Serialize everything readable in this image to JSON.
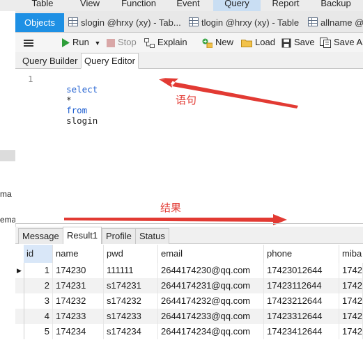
{
  "menu": [
    "Table",
    "View",
    "Function",
    "Event",
    "Query",
    "Report",
    "Backup"
  ],
  "menu_active": "Query",
  "left_tree": [
    "ma",
    "ema"
  ],
  "tabs": [
    {
      "label": "Objects",
      "active": true,
      "icon": ""
    },
    {
      "label": "slogin @hrxy (xy) - Tab...",
      "active": false,
      "icon": "table-icon"
    },
    {
      "label": "tlogin @hrxy (xy) - Table",
      "active": false,
      "icon": "table-icon"
    },
    {
      "label": "allname @",
      "active": false,
      "icon": "table-icon"
    }
  ],
  "toolbar": {
    "run": "Run",
    "stop": "Stop",
    "explain": "Explain",
    "new": "New",
    "load": "Load",
    "save": "Save",
    "save_as": "Save As"
  },
  "subtabs": [
    "Query Builder",
    "Query Editor"
  ],
  "editor": {
    "line_number": "1",
    "kw_select": "select",
    "star": "*",
    "kw_from": "from",
    "table": "slogin"
  },
  "annotations": {
    "statement": "语句",
    "result": "结果",
    "color": "#e23a33"
  },
  "result_tabs": [
    "Message",
    "Result1",
    "Profile",
    "Status"
  ],
  "grid": {
    "columns": [
      "id",
      "name",
      "pwd",
      "email",
      "phone",
      "miba"
    ],
    "rows": [
      [
        "1",
        "174230",
        "111111",
        "2644174230@qq.com",
        "17423012644",
        "1742"
      ],
      [
        "2",
        "174231",
        "s174231",
        "2644174231@qq.com",
        "17423112644",
        "1742"
      ],
      [
        "3",
        "174232",
        "s174232",
        "2644174232@qq.com",
        "17423212644",
        "1742"
      ],
      [
        "4",
        "174233",
        "s174233",
        "2644174233@qq.com",
        "17423312644",
        "1742"
      ],
      [
        "5",
        "174234",
        "s174234",
        "2644174234@qq.com",
        "17423412644",
        "1742"
      ]
    ]
  },
  "colors": {
    "accent": "#1e90e4",
    "keyword": "#1f5fd0",
    "run": "#2e9e3a"
  }
}
